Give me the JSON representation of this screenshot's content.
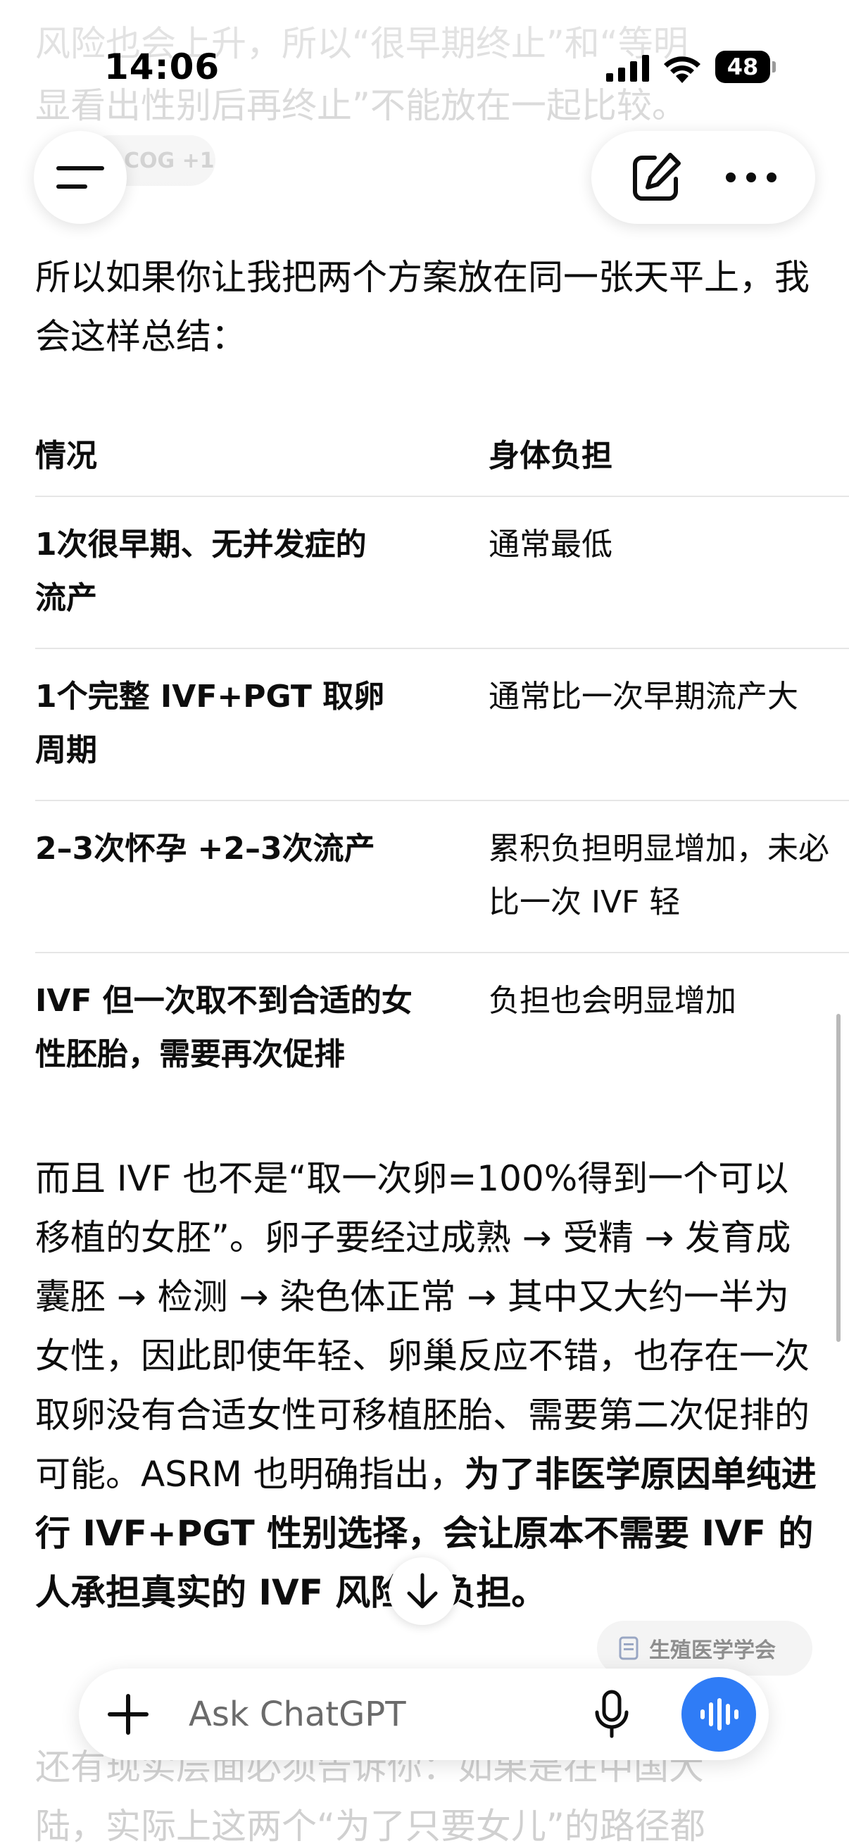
{
  "status_bar": {
    "time": "14:06",
    "battery": "48"
  },
  "top_faded": {
    "lines": [
      "风险也会上升，所以“很早期终止”和“等明",
      "显看出性别后再终止”不能放在一起比较。"
    ],
    "source_chip": "COG +1"
  },
  "intro": "所以如果你让我把两个方案放在同一张天平上，我会这样总结：",
  "table": {
    "headers": [
      "情况",
      "身体负担"
    ],
    "rows": [
      {
        "situation": [
          "1次很早期、无并发症的",
          "流产"
        ],
        "burden": [
          "通常最低"
        ]
      },
      {
        "situation": [
          "1个完整 IVF+PGT 取卵",
          "周期"
        ],
        "burden": [
          "通常比一次早期流产大"
        ]
      },
      {
        "situation": [
          "2–3次怀孕 +2–3次流产"
        ],
        "burden": [
          "累积负担明显增加，未必",
          "比一次 IVF 轻"
        ]
      },
      {
        "situation": [
          "IVF 但一次取不到合适的女",
          "性胚胎，需要再次促排"
        ],
        "burden": [
          "负担也会明显增加"
        ]
      }
    ]
  },
  "para2": {
    "text_normal": "而且 IVF 也不是“取一次卵=100%得到一个可以移植的女胚”。卵子要经过成熟 → 受精 → 发育成囊胚 → 检测 → 染色体正常 → 其中又大约一半为女性，因此即使年轻、卵巢反应不错，也存在一次取卵没有合适女性可移植胚胎、需要第二次促排的可能。ASRM 也明确指出，",
    "text_bold": "为了非医学原因单纯进行 IVF+PGT 性别选择，会让原本不需要 IVF 的人承担真实的 IVF 风险和负担。"
  },
  "source_chip": "生殖医学学会",
  "bottom_faded": {
    "lines": [
      "还有现实层面必须告诉你：如果是在中国大",
      "陆，实际上这两个“为了只要女儿”的路径都"
    ]
  },
  "composer": {
    "placeholder": "Ask ChatGPT"
  }
}
